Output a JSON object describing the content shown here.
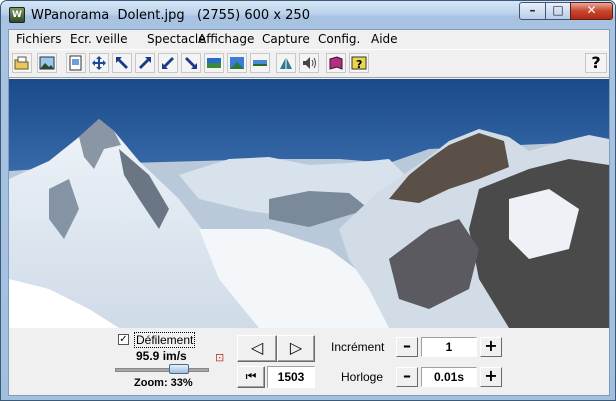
{
  "window": {
    "title": "WPanorama  Dolent.jpg   (2755) 600 x 250",
    "controls": {
      "minimize": "–",
      "maximize": "□",
      "close": "✕"
    },
    "app_icon_letter": "W"
  },
  "menu": [
    "Fichiers",
    "Ecr. veille",
    "Spectacle",
    "Affichage",
    "Capture",
    "Config.",
    "Aide"
  ],
  "toolbar": {
    "buttons": [
      "open-folder-icon",
      "image-icon",
      "copy-page-icon",
      "move-cross-icon",
      "arrow-up-left-icon",
      "arrow-diagonal-out-icon",
      "arrow-diagonal-in-icon",
      "arrow-down-right-icon",
      "panorama-strip-icon",
      "panorama-wide-icon",
      "panorama-thin-icon",
      "screen-saver-icon",
      "sound-icon",
      "book-icon",
      "help-book-icon"
    ],
    "help_label": "?"
  },
  "scroll": {
    "label": "Défilement",
    "checked": true,
    "check_mark": "✓",
    "speed": "95.9 im/s",
    "zoom": "Zoom: 33%",
    "zoom_fraction": 0.6
  },
  "playback": {
    "prev_glyph": "◁",
    "next_glyph": "▷",
    "first_glyph": "⏮",
    "position": "1503"
  },
  "increment": {
    "label": "Incrément",
    "value": "1",
    "minus": "–",
    "plus": "+"
  },
  "clock": {
    "label": "Horloge",
    "value": "0.01s",
    "minus": "–",
    "plus": "+"
  }
}
